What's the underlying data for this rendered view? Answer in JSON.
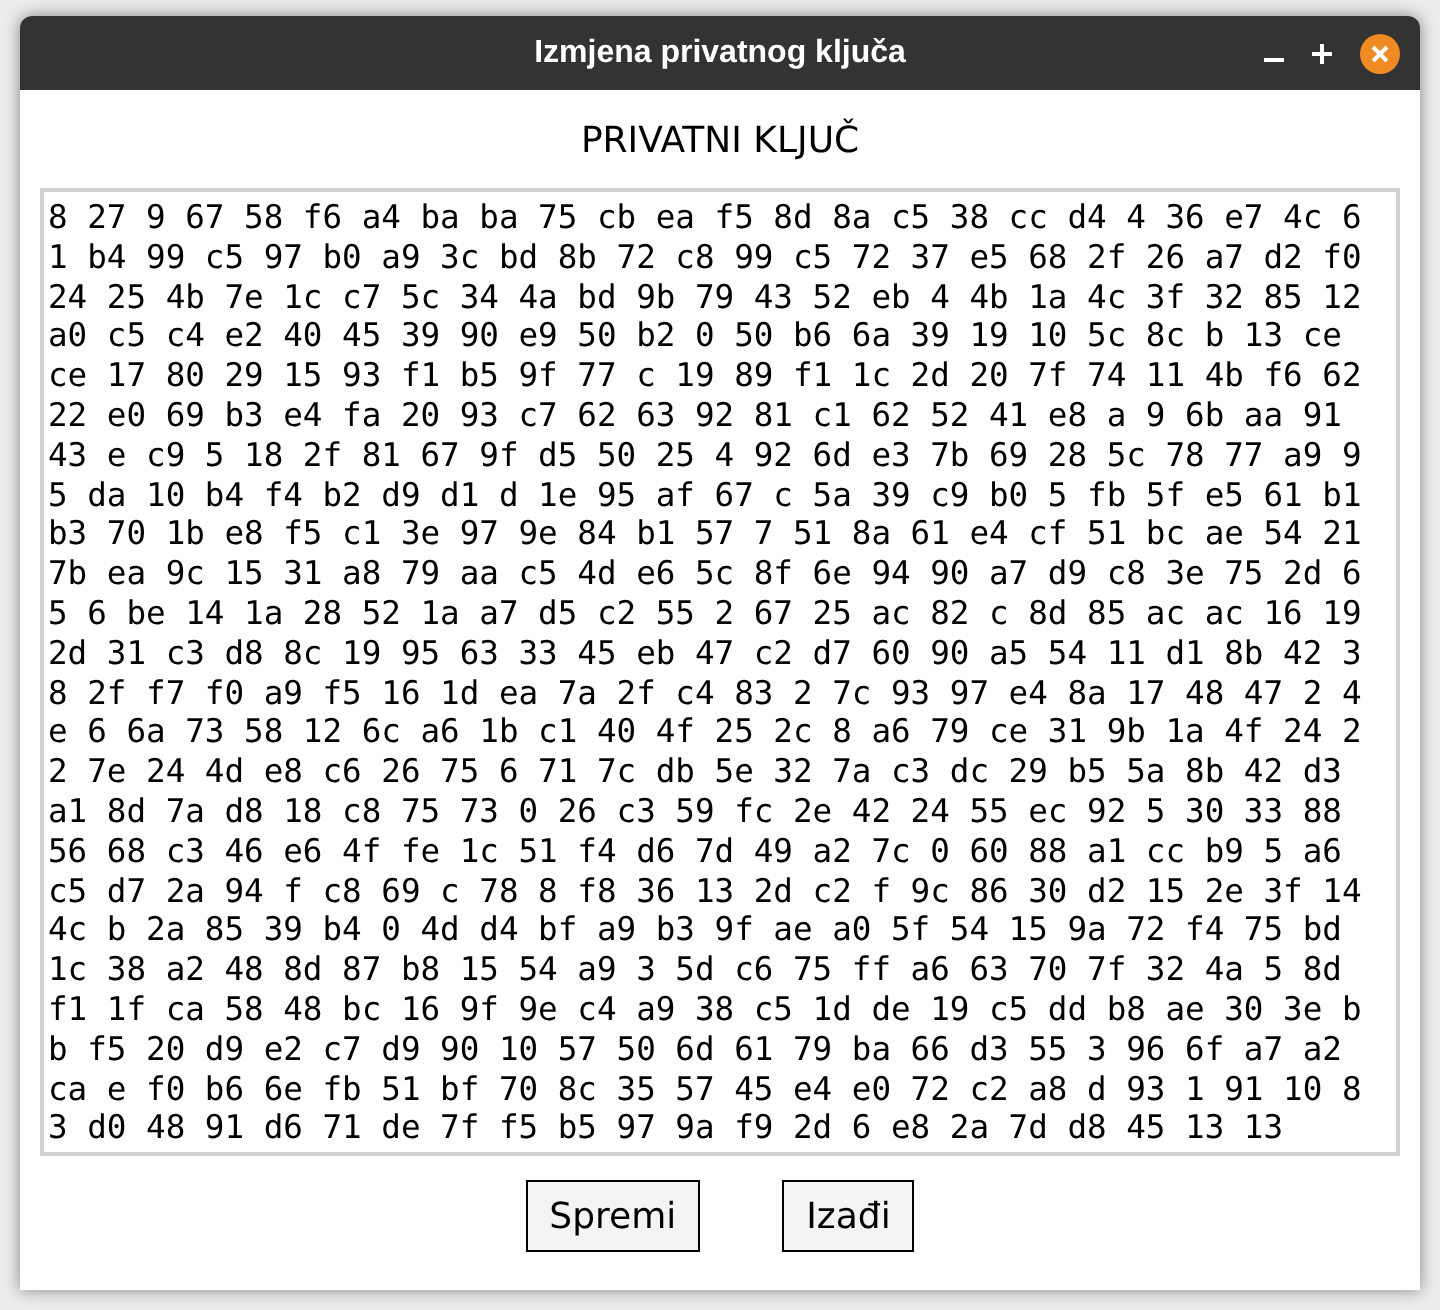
{
  "window": {
    "title": "Izmjena privatnog ključa"
  },
  "heading": "PRIVATNI KLJUČ",
  "key_text": {
    "lines": [
      "8 27 9 67 58 f6 a4 ba ba 75 cb ea f5 8d 8a c5 38 cc d4 4 36 e7 4c 6",
      "1 b4 99 c5 97 b0 a9 3c bd 8b 72 c8 99 c5 72 37 e5 68 2f 26 a7 d2 f0",
      "24 25 4b 7e 1c c7 5c 34 4a bd 9b 79 43 52 eb 4 4b 1a 4c 3f 32 85 12",
      "a0 c5 c4 e2 40 45 39 90 e9 50 b2 0 50 b6 6a 39 19 10 5c 8c b 13 ce",
      "ce 17 80 29 15 93 f1 b5 9f 77 c 19 89 f1 1c 2d 20 7f 74 11 4b f6 62",
      "22 e0 69 b3 e4 fa 20 93 c7 62 63 92 81 c1 62 52 41 e8 a 9 6b aa 91",
      "43 e c9 5 18 2f 81 67 9f d5 50 25 4 92 6d e3 7b 69 28 5c 78 77 a9 9",
      "5 da 10 b4 f4 b2 d9 d1 d 1e 95 af 67 c 5a 39 c9 b0 5 fb 5f e5 61 b1",
      "b3 70 1b e8 f5 c1 3e 97 9e 84 b1 57 7 51 8a 61 e4 cf 51 bc ae 54 21",
      "7b ea 9c 15 31 a8 79 aa c5 4d e6 5c 8f 6e 94 90 a7 d9 c8 3e 75 2d 6",
      "5 6 be 14 1a 28 52 1a a7 d5 c2 55 2 67 25 ac 82 c 8d 85 ac ac 16 19",
      "2d 31 c3 d8 8c 19 95 63 33 45 eb 47 c2 d7 60 90 a5 54 11 d1 8b 42 3",
      "8 2f f7 f0 a9 f5 16 1d ea 7a 2f c4 83 2 7c 93 97 e4 8a 17 48 47 2 4",
      "e 6 6a 73 58 12 6c a6 1b c1 40 4f 25 2c 8 a6 79 ce 31 9b 1a 4f 24 2",
      "2 7e 24 4d e8 c6 26 75 6 71 7c db 5e 32 7a c3 dc 29 b5 5a 8b 42 d3",
      "a1 8d 7a d8 18 c8 75 73 0 26 c3 59 fc 2e 42 24 55 ec 92 5 30 33 88",
      "56 68 c3 46 e6 4f fe 1c 51 f4 d6 7d 49 a2 7c 0 60 88 a1 cc b9 5 a6",
      "c5 d7 2a 94 f c8 69 c 78 8 f8 36 13 2d c2 f 9c 86 30 d2 15 2e 3f 14",
      "4c b 2a 85 39 b4 0 4d d4 bf a9 b3 9f ae a0 5f 54 15 9a 72 f4 75 bd",
      "1c 38 a2 48 8d 87 b8 15 54 a9 3 5d c6 75 ff a6 63 70 7f 32 4a 5 8d",
      "f1 1f ca 58 48 bc 16 9f 9e c4 a9 38 c5 1d de 19 c5 dd b8 ae 30 3e b",
      "b f5 20 d9 e2 c7 d9 90 10 57 50 6d 61 79 ba 66 d3 55 3 96 6f a7 a2",
      "ca e f0 b6 6e fb 51 bf 70 8c 35 57 45 e4 e0 72 c2 a8 d 93 1 91 10 8",
      "3 d0 48 91 d6 71 de 7f f5 b5 97 9a f9 2d 6 e8 2a 7d d8 45 13 13"
    ]
  },
  "buttons": [
    "Spremi",
    "Izađi"
  ]
}
